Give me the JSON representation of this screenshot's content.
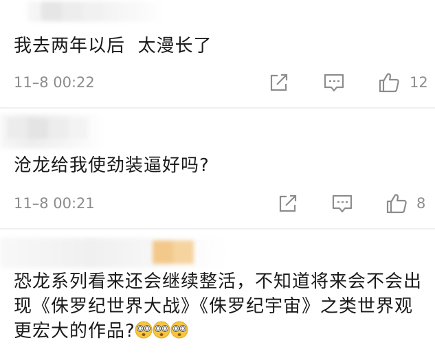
{
  "comments": [
    {
      "text": "我去两年以后  太漫长了",
      "time": "11–8  00:22",
      "likes": "12"
    },
    {
      "text": "沧龙给我使劲装逼好吗?",
      "time": "11–8  00:21",
      "likes": "8"
    },
    {
      "text": "恐龙系列看来还会继续整活，不知道将来会不会出现《侏罗纪世界大战》《侏罗纪宇宙》之类世界观更宏大的作品?"
    }
  ],
  "icons": {
    "share": "share-icon",
    "comment": "comment-icon",
    "like": "thumbs-up-icon",
    "reaction_emoji": "dizzy-face-emoji"
  },
  "colors": {
    "text": "#1a1a1a",
    "meta": "#8c8c8c",
    "icon": "#8c8c8c",
    "divider": "#f0f0f0",
    "emoji_face": "#f5c542"
  }
}
